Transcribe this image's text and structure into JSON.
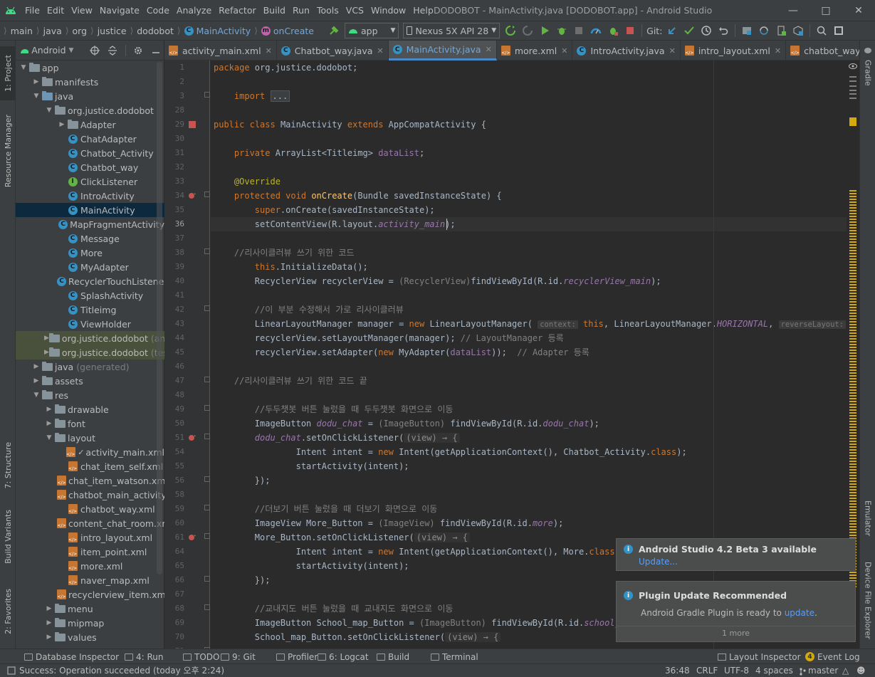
{
  "titlebar": {
    "menu": [
      "File",
      "Edit",
      "View",
      "Navigate",
      "Code",
      "Analyze",
      "Refactor",
      "Build",
      "Run",
      "Tools",
      "VCS",
      "Window",
      "Help"
    ],
    "title": "DODOBOT - MainActivity.java [DODOBOT.app] - Android Studio"
  },
  "breadcrumb": [
    "main",
    "java",
    "org",
    "justice",
    "dodobot",
    "MainActivity",
    "onCreate"
  ],
  "toolbar": {
    "run_config": "app",
    "device": "Nexus 5X API 28",
    "git_label": "Git:"
  },
  "project_panel": {
    "view_mode": "Android",
    "tree": [
      {
        "label": "app",
        "level": 0,
        "icon": "folder",
        "expanded": true
      },
      {
        "label": "manifests",
        "level": 1,
        "icon": "folder",
        "expanded": false
      },
      {
        "label": "java",
        "level": 1,
        "icon": "folder-blue",
        "expanded": true
      },
      {
        "label": "org.justice.dodobot",
        "level": 2,
        "icon": "package",
        "expanded": true
      },
      {
        "label": "Adapter",
        "level": 3,
        "icon": "package",
        "expanded": false
      },
      {
        "label": "ChatAdapter",
        "level": 3,
        "icon": "class"
      },
      {
        "label": "Chatbot_Activity",
        "level": 3,
        "icon": "class"
      },
      {
        "label": "Chatbot_way",
        "level": 3,
        "icon": "class"
      },
      {
        "label": "ClickListener",
        "level": 3,
        "icon": "interface"
      },
      {
        "label": "IntroActivity",
        "level": 3,
        "icon": "class"
      },
      {
        "label": "MainActivity",
        "level": 3,
        "icon": "class",
        "selected": true
      },
      {
        "label": "MapFragmentActivity",
        "level": 3,
        "icon": "class"
      },
      {
        "label": "Message",
        "level": 3,
        "icon": "class"
      },
      {
        "label": "More",
        "level": 3,
        "icon": "class"
      },
      {
        "label": "MyAdapter",
        "level": 3,
        "icon": "class"
      },
      {
        "label": "RecyclerTouchListener",
        "level": 3,
        "icon": "class"
      },
      {
        "label": "SplashActivity",
        "level": 3,
        "icon": "class"
      },
      {
        "label": "Titleimg",
        "level": 3,
        "icon": "class"
      },
      {
        "label": "ViewHolder",
        "level": 3,
        "icon": "class"
      },
      {
        "label": "org.justice.dodobot",
        "suffix": "(andr",
        "level": 2,
        "icon": "package",
        "expanded": false,
        "dimmed": true
      },
      {
        "label": "org.justice.dodobot",
        "suffix": "(test)",
        "level": 2,
        "icon": "package",
        "expanded": false,
        "dimmed": true
      },
      {
        "label": "java",
        "suffix": "(generated)",
        "level": 1,
        "icon": "folder",
        "expanded": false
      },
      {
        "label": "assets",
        "level": 1,
        "icon": "folder",
        "expanded": false
      },
      {
        "label": "res",
        "level": 1,
        "icon": "folder",
        "expanded": true
      },
      {
        "label": "drawable",
        "level": 2,
        "icon": "folder",
        "expanded": false
      },
      {
        "label": "font",
        "level": 2,
        "icon": "folder",
        "expanded": false
      },
      {
        "label": "layout",
        "level": 2,
        "icon": "folder",
        "expanded": true
      },
      {
        "label": "activity_main.xml",
        "level": 3,
        "icon": "xml",
        "check": true
      },
      {
        "label": "chat_item_self.xml",
        "level": 3,
        "icon": "xml"
      },
      {
        "label": "chat_item_watson.xml",
        "level": 3,
        "icon": "xml"
      },
      {
        "label": "chatbot_main_activity",
        "level": 3,
        "icon": "xml"
      },
      {
        "label": "chatbot_way.xml",
        "level": 3,
        "icon": "xml"
      },
      {
        "label": "content_chat_room.xml",
        "level": 3,
        "icon": "xml"
      },
      {
        "label": "intro_layout.xml",
        "level": 3,
        "icon": "xml"
      },
      {
        "label": "item_point.xml",
        "level": 3,
        "icon": "xml"
      },
      {
        "label": "more.xml",
        "level": 3,
        "icon": "xml"
      },
      {
        "label": "naver_map.xml",
        "level": 3,
        "icon": "xml"
      },
      {
        "label": "recyclerview_item.xml",
        "level": 3,
        "icon": "xml"
      },
      {
        "label": "menu",
        "level": 2,
        "icon": "folder",
        "expanded": false
      },
      {
        "label": "mipmap",
        "level": 2,
        "icon": "folder",
        "expanded": false
      },
      {
        "label": "values",
        "level": 2,
        "icon": "folder",
        "expanded": false
      }
    ]
  },
  "editor_tabs": [
    {
      "label": "activity_main.xml",
      "icon": "xml"
    },
    {
      "label": "Chatbot_way.java",
      "icon": "class"
    },
    {
      "label": "MainActivity.java",
      "icon": "class",
      "active": true
    },
    {
      "label": "more.xml",
      "icon": "xml"
    },
    {
      "label": "IntroActivity.java",
      "icon": "class"
    },
    {
      "label": "intro_layout.xml",
      "icon": "xml"
    },
    {
      "label": "chatbot_way.xml",
      "icon": "xml"
    }
  ],
  "editor": {
    "line_numbers": [
      "1",
      "2",
      "3",
      "28",
      "29",
      "30",
      "31",
      "32",
      "33",
      "34",
      "35",
      "36",
      "37",
      "38",
      "39",
      "40",
      "41",
      "42",
      "43",
      "44",
      "45",
      "46",
      "47",
      "48",
      "49",
      "50",
      "51",
      "54",
      "55",
      "56",
      "58",
      "59",
      "60",
      "61",
      "64",
      "65",
      "66",
      "67",
      "68",
      "69",
      "70",
      "71"
    ],
    "lines": [
      "package org.justice.dodobot;",
      "",
      "    import ...",
      "",
      "public class MainActivity extends AppCompatActivity {",
      "",
      "    private ArrayList<Titleimg> dataList;",
      "",
      "    @Override",
      "    protected void onCreate(Bundle savedInstanceState) {",
      "        super.onCreate(savedInstanceState);",
      "        setContentView(R.layout.activity_main);",
      "",
      "    //리사이클러뷰 쓰기 위한 코드",
      "        this.InitializeData();",
      "        RecyclerView recyclerView = (RecyclerView)findViewById(R.id.recyclerView_main);",
      "",
      "        //이 부분 수정해서 가로 리사이클러뷰",
      "        LinearLayoutManager manager = new LinearLayoutManager( context: this, LinearLayoutManager.HORIZONTAL, reverseLayout: false);",
      "        recyclerView.setLayoutManager(manager); // LayoutManager 등록",
      "        recyclerView.setAdapter(new MyAdapter(dataList));  // Adapter 등록",
      "",
      "    //리사이클러뷰 쓰기 위한 코드 끝",
      "",
      "        //두두챗봇 버튼 눌렀을 때 두두챗봇 화면으로 이동",
      "        ImageButton dodu_chat = (ImageButton) findViewById(R.id.dodu_chat);",
      "        dodu_chat.setOnClickListener((view) → {",
      "                Intent intent = new Intent(getApplicationContext(), Chatbot_Activity.class);",
      "                startActivity(intent);",
      "        });",
      "",
      "        //더보기 버튼 눌렀을 때 더보기 화면으로 이동",
      "        ImageView More_Button = (ImageView) findViewById(R.id.more);",
      "        More_Button.setOnClickListener((view) → {",
      "                Intent intent = new Intent(getApplicationContext(), More.class);",
      "                startActivity(intent);",
      "        });",
      "",
      "        //교내지도 버튼 눌렀을 때 교내지도 화면으로 이동",
      "        ImageButton School_map_Button = (ImageButton) findViewById(R.id.school_ma",
      "        School_map_Button.setOnClickListener((view) → {"
    ]
  },
  "notifications": [
    {
      "title": "Android Studio 4.2 Beta 3 available",
      "link": "Update..."
    },
    {
      "title": "Plugin Update Recommended",
      "body": "Android Gradle Plugin is ready to ",
      "link": "update",
      "body_end": ".",
      "footer": "1 more"
    }
  ],
  "left_strip": {
    "project": "1: Project",
    "resource_manager": "Resource Manager",
    "structure": "7: Structure",
    "build_variants": "Build Variants",
    "favorites": "2: Favorites"
  },
  "right_strip": {
    "gradle": "Gradle",
    "emulator": "Emulator",
    "device_file_explorer": "Device File Explorer"
  },
  "bottom_tools": [
    "Database Inspector",
    "4: Run",
    "TODO",
    "9: Git",
    "Profiler",
    "6: Logcat",
    "Build",
    "Terminal"
  ],
  "bottom_right_tools": {
    "layout_inspector": "Layout Inspector",
    "event_log": "Event Log",
    "event_count": "4"
  },
  "status": {
    "message": "Success: Operation succeeded (today 오후 2:24)",
    "position": "36:48",
    "line_sep": "CRLF",
    "encoding": "UTF-8",
    "indent": "4 spaces",
    "branch": "master"
  },
  "colors": {
    "accent": "#4a88c7",
    "selected_row": "#0d293e",
    "warning_marker": "#d6a90a"
  }
}
